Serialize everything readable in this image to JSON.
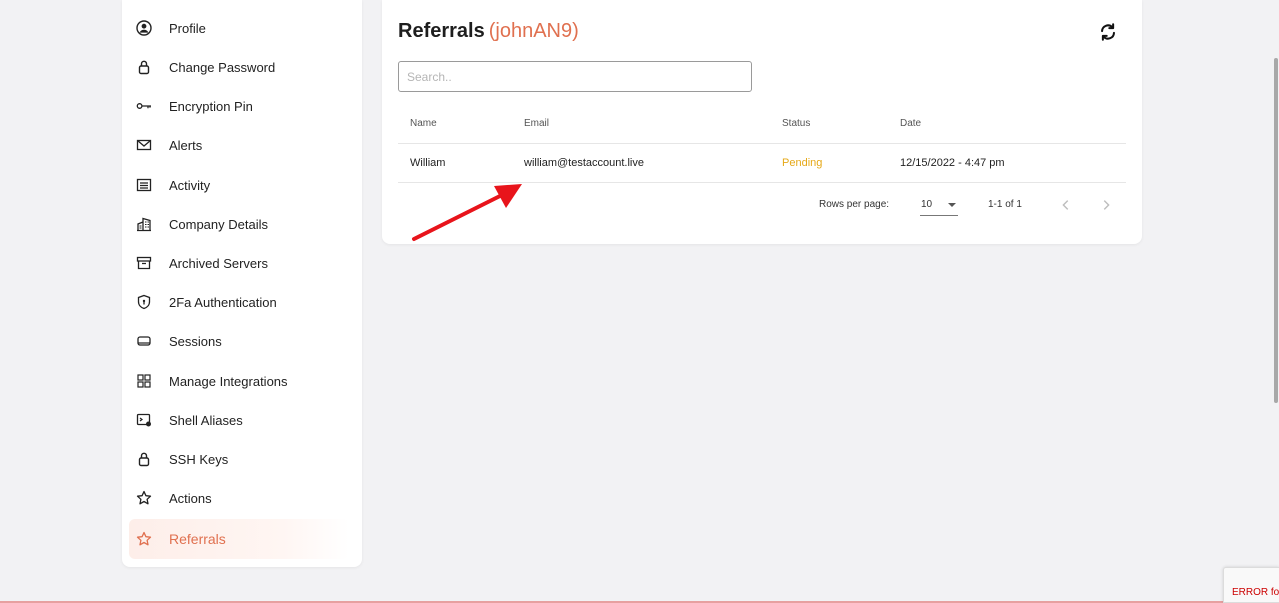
{
  "sidebar": {
    "items": [
      {
        "label": "Profile",
        "icon": "profile-icon"
      },
      {
        "label": "Change Password",
        "icon": "lock-icon"
      },
      {
        "label": "Encryption Pin",
        "icon": "key-icon"
      },
      {
        "label": "Alerts",
        "icon": "mail-icon"
      },
      {
        "label": "Activity",
        "icon": "list-icon"
      },
      {
        "label": "Company Details",
        "icon": "building-icon"
      },
      {
        "label": "Archived Servers",
        "icon": "archive-icon"
      },
      {
        "label": "2Fa Authentication",
        "icon": "shield-icon"
      },
      {
        "label": "Sessions",
        "icon": "sessions-icon"
      },
      {
        "label": "Manage Integrations",
        "icon": "grid-icon"
      },
      {
        "label": "Shell Aliases",
        "icon": "terminal-icon"
      },
      {
        "label": "SSH Keys",
        "icon": "lock-icon"
      },
      {
        "label": "Actions",
        "icon": "star-icon"
      },
      {
        "label": "Referrals",
        "icon": "star-icon",
        "active": true
      }
    ]
  },
  "main": {
    "title": "Referrals",
    "username": "(johnAN9)",
    "search_placeholder": "Search..",
    "table": {
      "headers": {
        "name": "Name",
        "email": "Email",
        "status": "Status",
        "date": "Date"
      },
      "rows": [
        {
          "name": "William",
          "email": "william@testaccount.live",
          "status": "Pending",
          "date": "12/15/2022 - 4:47 pm"
        }
      ]
    },
    "pagination": {
      "rows_per_page_label": "Rows per page:",
      "rows_per_page_value": "10",
      "range": "1-1 of 1"
    }
  },
  "error_widget": {
    "text": "ERROR fo"
  },
  "colors": {
    "accent": "#e0704f",
    "pending": "#e6a817",
    "annotation_arrow": "#e8141b"
  }
}
